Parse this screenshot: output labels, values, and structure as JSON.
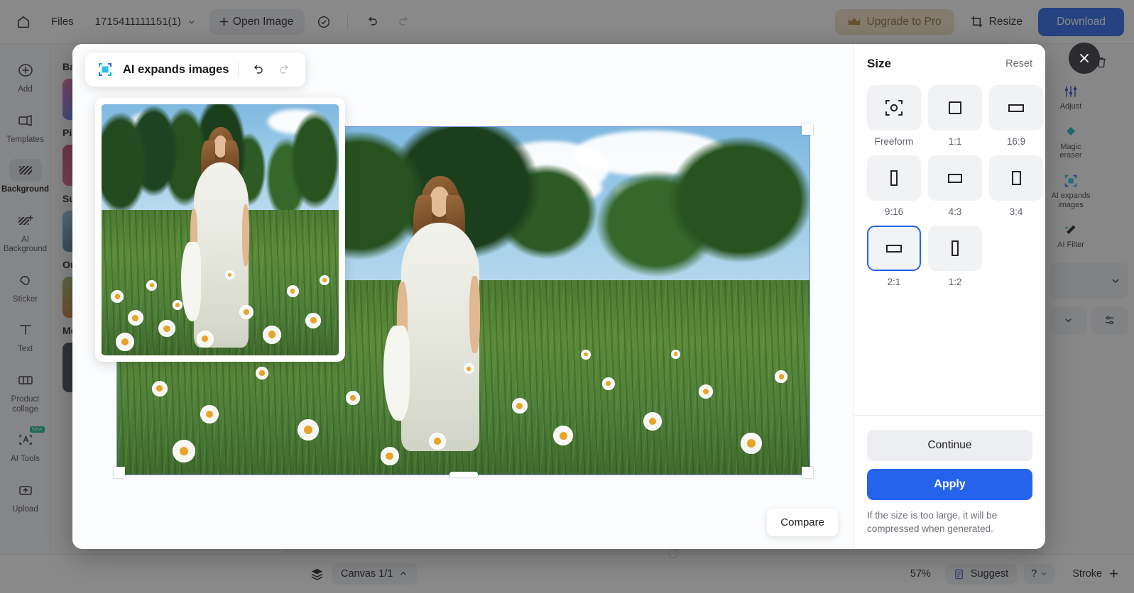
{
  "topbar": {
    "home_icon": "home-icon",
    "files_label": "Files",
    "filename": "1715411111151(1)",
    "filename_caret": "chevron-down-icon",
    "open_image_label": "Open Image",
    "cloud_icon": "cloud-check-icon",
    "undo_icon": "undo-icon",
    "redo_icon": "redo-icon",
    "upgrade_label": "Upgrade to Pro",
    "upgrade_icon": "crown-icon",
    "resize_label": "Resize",
    "resize_icon": "resize-icon",
    "download_label": "Download",
    "accent_blue": "#2563eb",
    "upgrade_bg": "#f0dfc4",
    "upgrade_fg": "#8a6a36"
  },
  "rail": {
    "items": [
      {
        "label": "Add",
        "icon": "plus-circle-icon",
        "active": false,
        "badge": ""
      },
      {
        "label": "Templates",
        "icon": "templates-icon",
        "active": false,
        "badge": ""
      },
      {
        "label": "Background",
        "icon": "background-icon",
        "active": true,
        "badge": ""
      },
      {
        "label": "AI Background",
        "icon": "ai-background-icon",
        "active": false,
        "badge": ""
      },
      {
        "label": "Sticker",
        "icon": "sticker-icon",
        "active": false,
        "badge": ""
      },
      {
        "label": "Text",
        "icon": "text-icon",
        "active": false,
        "badge": ""
      },
      {
        "label": "Product collage",
        "icon": "product-collage-icon",
        "active": false,
        "badge": ""
      },
      {
        "label": "AI Tools",
        "icon": "ai-tools-icon",
        "active": false,
        "badge": "New"
      },
      {
        "label": "Upload",
        "icon": "upload-icon",
        "active": false,
        "badge": ""
      }
    ]
  },
  "left_panel": {
    "sections": [
      {
        "title": "Background"
      },
      {
        "title": "Picture"
      },
      {
        "title": "Summer"
      },
      {
        "title": "Outdoor"
      },
      {
        "title": "More"
      }
    ]
  },
  "right_panel": {
    "tools": [
      {
        "label": "Adjust",
        "icon": "adjust-icon"
      },
      {
        "label": "Magic eraser",
        "icon": "magic-eraser-icon"
      },
      {
        "label": "AI expands images",
        "icon": "ai-expand-icon"
      },
      {
        "label": "AI Filter",
        "icon": "ai-filter-icon"
      }
    ],
    "duplicate_icon": "duplicate-icon",
    "delete_icon": "trash-icon",
    "collapse_icon": "chevron-down-icon",
    "settings_icon": "sliders-icon"
  },
  "bottombar": {
    "layers_icon": "layers-icon",
    "canvas_label": "Canvas 1/1",
    "canvas_caret": "chevron-up-icon",
    "zoom_label": "57%",
    "suggest_label": "Suggest",
    "suggest_icon": "suggest-icon",
    "help_label": "?",
    "help_caret": "chevron-down-icon",
    "stroke_label": "Stroke",
    "add_icon": "plus-icon",
    "refresh_icon": "refresh-icon"
  },
  "modal": {
    "title": "AI expands images",
    "title_icon": "ai-expand-icon",
    "undo_icon": "undo-icon",
    "redo_icon": "redo-icon",
    "compare_label": "Compare",
    "close_icon": "close-icon",
    "side": {
      "title": "Size",
      "reset_label": "Reset",
      "ratios": [
        {
          "label": "Freeform",
          "shape": "freeform",
          "selected": false
        },
        {
          "label": "1:1",
          "shape": "square",
          "selected": false
        },
        {
          "label": "16:9",
          "shape": "wide",
          "selected": false
        },
        {
          "label": "9:16",
          "shape": "tall-narrow",
          "selected": false
        },
        {
          "label": "4:3",
          "shape": "landscape",
          "selected": false
        },
        {
          "label": "3:4",
          "shape": "portrait",
          "selected": false
        },
        {
          "label": "2:1",
          "shape": "wide",
          "selected": true
        },
        {
          "label": "1:2",
          "shape": "tall-narrow",
          "selected": false
        }
      ],
      "continue_label": "Continue",
      "apply_label": "Apply",
      "note": "If the size is too large, it will be compressed when generated."
    }
  }
}
